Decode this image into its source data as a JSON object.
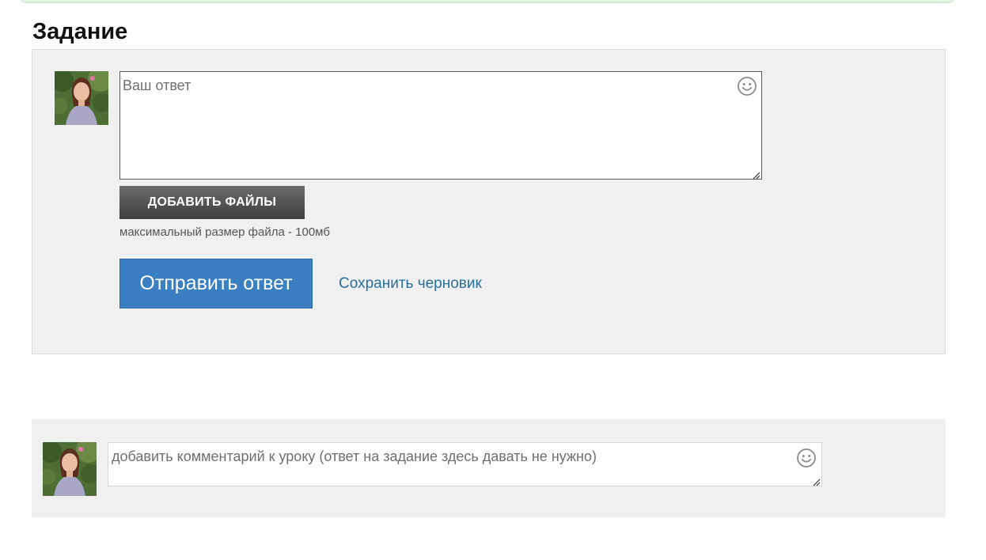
{
  "section": {
    "title": "Задание"
  },
  "task_form": {
    "answer_placeholder": "Ваш ответ",
    "add_files_label": "ДОБАВИТЬ ФАЙЛЫ",
    "file_size_hint": "максимальный размер файла - 100мб",
    "submit_label": "Отправить ответ",
    "save_draft_label": "Сохранить черновик",
    "emoji_icon": "smiley-icon"
  },
  "comment_form": {
    "placeholder": "добавить комментарий к уроку (ответ на задание здесь давать не нужно)",
    "emoji_icon": "smiley-icon"
  },
  "colors": {
    "panel_background": "#f0f0f0",
    "submit_button": "#3a7fc1",
    "add_files_button": "#4a4a4a",
    "link": "#26709b"
  }
}
